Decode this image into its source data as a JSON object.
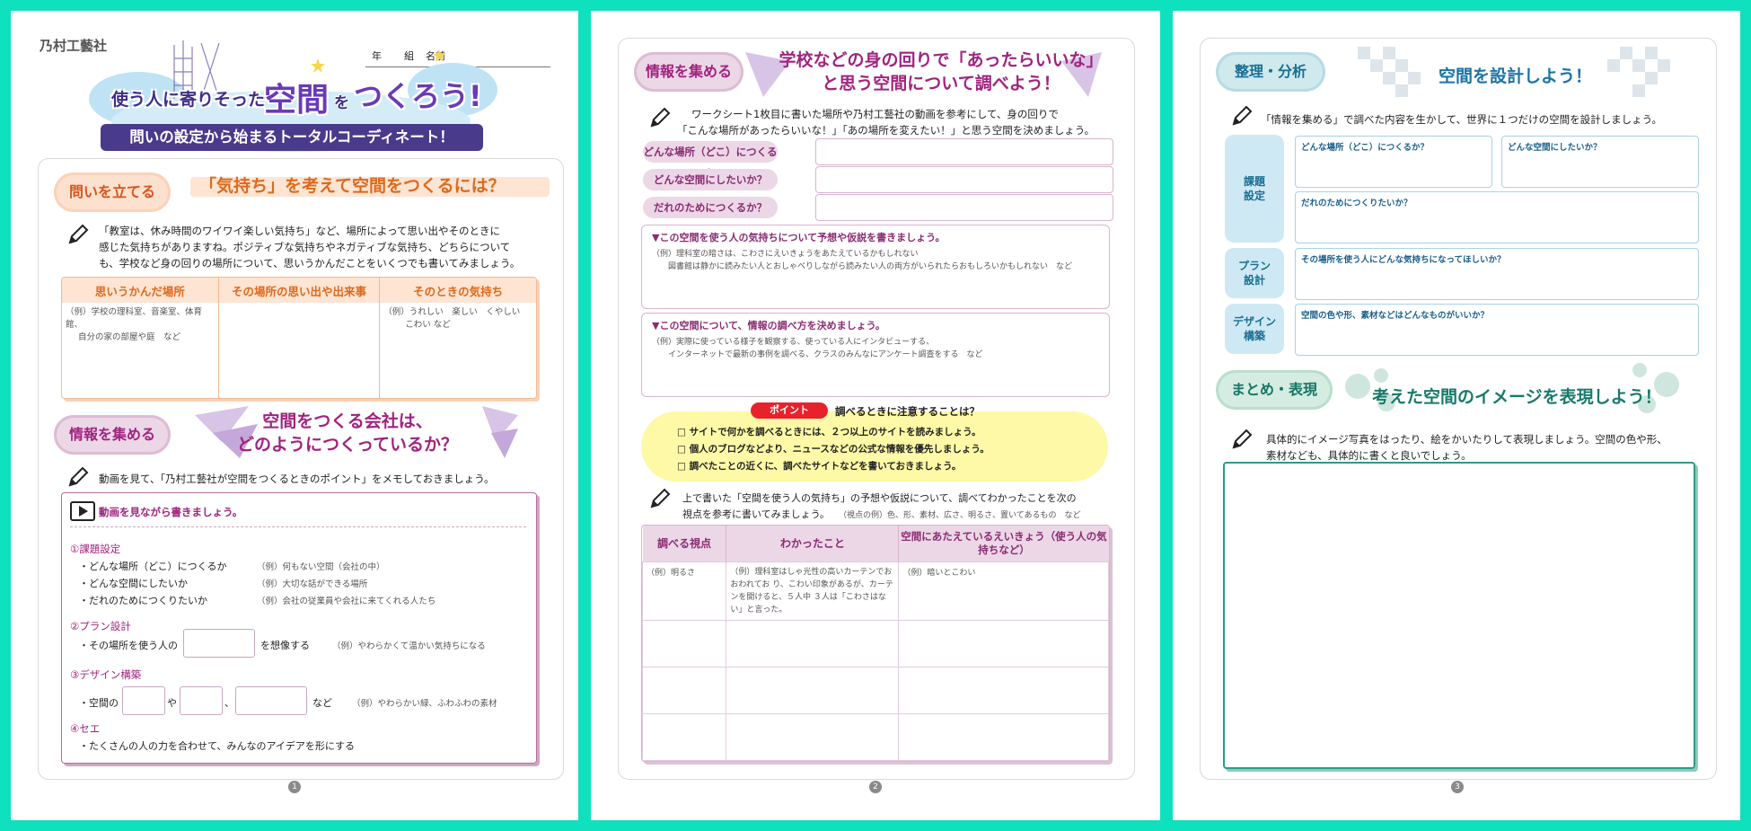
{
  "page1": {
    "company": "乃村工藝社",
    "name_fields": {
      "year": "年",
      "class": "組",
      "name": "名前"
    },
    "banner": {
      "line1_prefix": "使う人に寄りそった",
      "line1_main": "空間",
      "line1_wo": "を",
      "line1_suffix": "つくろう!",
      "line2": "問いの設定から始まるトータルコーディネート！"
    },
    "s1": {
      "pill": "問いを立てる",
      "title": "「気持ち」を考えて空間をつくるには？",
      "body": [
        "「教室は、休み時間のワイワイ楽しい気持ち」など、場所によって思い出やそのときに",
        "感じた気持ちがありますね。ポジティブな気持ちやネガティブな気持ち、どちらについて",
        "も、学校など身の回りの場所について、思いうかんだことをいくつでも書いてみましょう。"
      ],
      "table_headers": [
        "思いうかんだ場所",
        "その場所の思い出や出来事",
        "そのときの気持ち"
      ],
      "ex_place": [
        "（例）学校の理科室、音楽室、体育館、",
        "自分の家の部屋や庭　など"
      ],
      "ex_feel": [
        "（例）うれしい　楽しい　くやしい",
        "こわい など"
      ]
    },
    "s2": {
      "pill": "情報を集める",
      "title_l1": "空間をつくる会社は、",
      "title_l2": "どのようにつくっているか？",
      "body": "動画を見て、「乃村工藝社が空間をつくるときのポイント」をメモしておきましょう。",
      "video_label": "動画を見ながら書きましょう。",
      "item1": "①課題設定",
      "i1_rows": [
        "・どんな場所（どこ）につくるか",
        "・どんな空間にしたいか",
        "・だれのためにつくりたいか"
      ],
      "i1_ex": [
        "（例）何もない空間（会社の中）",
        "（例）大切な話ができる場所",
        "（例）会社の従業員や会社に来てくれる人たち"
      ],
      "item2": "②プラン設計",
      "i2_pre": "・その場所を使う人の",
      "i2_post": "を想像する",
      "i2_ex": "（例）やわらかくて温かい気持ちになる",
      "item3": "③デザイン構築",
      "i3_pre": "・空間の",
      "i3_ya": "や",
      "i3_comma": "、",
      "i3_nado": "など",
      "i3_ex": "（例）やわらかい緑、ふわふわの素材",
      "item4": "④セエ",
      "i4_row": "・たくさんの人の力を合わせて、みんなのアイデアを形にする"
    },
    "page_no": "1"
  },
  "page2": {
    "pill": "情報を集める",
    "title_l1": "学校などの身の回りで「あったらいいな」",
    "title_l2": "と思う空間について調べよう！",
    "intro": [
      "ワークシート1枚目に書いた場所や乃村工藝社の動画を参考にして、身の回りで",
      "「こんな場所があったらいいな！」「あの場所を変えたい！」と思う空間を決めましょう。"
    ],
    "fields": [
      "どんな場所（どこ）につくるか",
      "どんな空間にしたいか？",
      "だれのためにつくるか？"
    ],
    "box1_title": "▼この空間を使う人の気持ちについて予想や仮説を書きましょう。",
    "box1_ex": [
      "（例）理科室の暗さは、こわさにえいきょうをあたえているかもしれない",
      "図書館は静かに読みたい人とおしゃべりしながら読みたい人の両方がいられたらおもしろいかもしれない　など"
    ],
    "box2_title": "▼この空間について、情報の調べ方を決めましょう。",
    "box2_ex": [
      "（例）実際に使っている様子を観察する、使っている人にインタビューする、",
      "インターネットで最新の事例を調べる、クラスのみんなにアンケート調査をする　など"
    ],
    "point_label": "ポイント",
    "point_title": "調べるときに注意することは？",
    "point_items": [
      "□ サイトで何かを調べるときには、２つ以上のサイトを読みましょう。",
      "□ 個人のブログなどより、ニュースなどの公式な情報を優先しましょう。",
      "□ 調べたことの近くに、調べたサイトなどを書いておきましょう。"
    ],
    "body2": [
      "上で書いた「空間を使う人の気持ち」の予想や仮説について、調べてわかったことを次の",
      "視点を参考に書いてみましょう。"
    ],
    "body2_note": "（視点の例）色、形、素材、広さ、明るさ、置いてあるもの　など",
    "table_headers": [
      "調べる視点",
      "わかったこと",
      "空間にあたえているえいきょう（使う人の気持ちなど）"
    ],
    "ex_row": [
      "（例）明るさ",
      "（例）理科室はしゃ光性の高いカーテンでおおわれてお り、こわい印象があるが、カーテンを開けると、５人中 ３人は「こわさはない」と言った。",
      "（例）暗いとこわい"
    ],
    "page_no": "2"
  },
  "page3": {
    "pill": "整理・分析",
    "title": "空間を設計しよう！",
    "intro": "「情報を集める」で調べた内容を生かして、世界に１つだけの空間を設計しましょう。",
    "rows": [
      {
        "label": [
          "課題",
          "設定"
        ],
        "cells": [
          "どんな場所（どこ）につくるか？",
          "どんな空間にしたいか？",
          "だれのためにつくりたいか？"
        ]
      },
      {
        "label": [
          "プラン",
          "設計"
        ],
        "cells": [
          "その場所を使う人にどんな気持ちになってほしいか？"
        ]
      },
      {
        "label": [
          "デザイン",
          "構築"
        ],
        "cells": [
          "空間の色や形、素材などはどんなものがいいか？"
        ]
      }
    ],
    "pill2": "まとめ・表現",
    "title2": "考えた空間のイメージを表現しよう！",
    "body2": [
      "具体的にイメージ写真をはったり、絵をかいたりして表現しましょう。空間の色や形、",
      "素材なども、具体的に書くと良いでしょう。"
    ],
    "page_no": "3"
  },
  "colors": {
    "bg": "#0fe0bd",
    "orange": "#dd6a1c",
    "purple": "#a0237f",
    "teal": "#1a73a6",
    "green": "#177a6a"
  }
}
